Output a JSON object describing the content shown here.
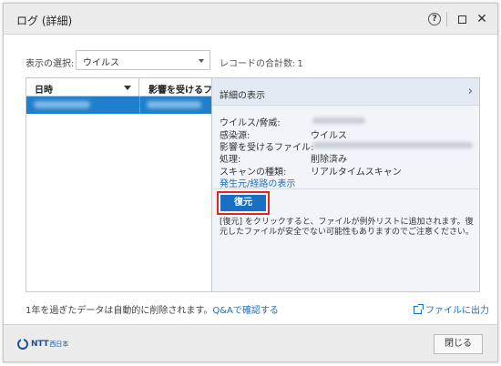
{
  "window": {
    "title": "ログ (詳細)",
    "help_glyph": "?",
    "close_glyph": "✕"
  },
  "filter": {
    "label": "表示の選択:",
    "selected": "ウイルス",
    "record_total_label": "レコードの合計数:",
    "record_total_value": "1"
  },
  "list": {
    "columns": [
      "日時",
      "影響を受けるファ"
    ],
    "rows": [
      {
        "date": "",
        "file": "",
        "selected": true
      }
    ]
  },
  "detail": {
    "header": "詳細の表示",
    "chevron": "›",
    "fields": [
      {
        "label": "ウイルス/脅威:",
        "value": ""
      },
      {
        "label": "感染源:",
        "value": "ウイルス"
      },
      {
        "label": "影響を受けるファイル:",
        "value": ""
      },
      {
        "label": "処理:",
        "value": "削除済み"
      },
      {
        "label": "スキャンの種類:",
        "value": "リアルタイムスキャン"
      }
    ],
    "route_link": "発生元/経路の表示",
    "restore_button": "復元",
    "restore_note": "[復元] をクリックすると、ファイルが例外リストに追加されます。復元したファイルが安全でない可能性もありますのでご注意ください。"
  },
  "footer": {
    "note_prefix": "1年を過ぎたデータは自動的に削除されます。",
    "qa_link": "Q&Aで確認する",
    "export_link": "ファイルに出力"
  },
  "bottom": {
    "logo_text": "NTT",
    "logo_sub": "西日本",
    "close_button": "閉じる"
  },
  "colors": {
    "accent": "#1a6fc4",
    "selection": "#1f7fcc",
    "highlight_outline": "#e0271f"
  }
}
